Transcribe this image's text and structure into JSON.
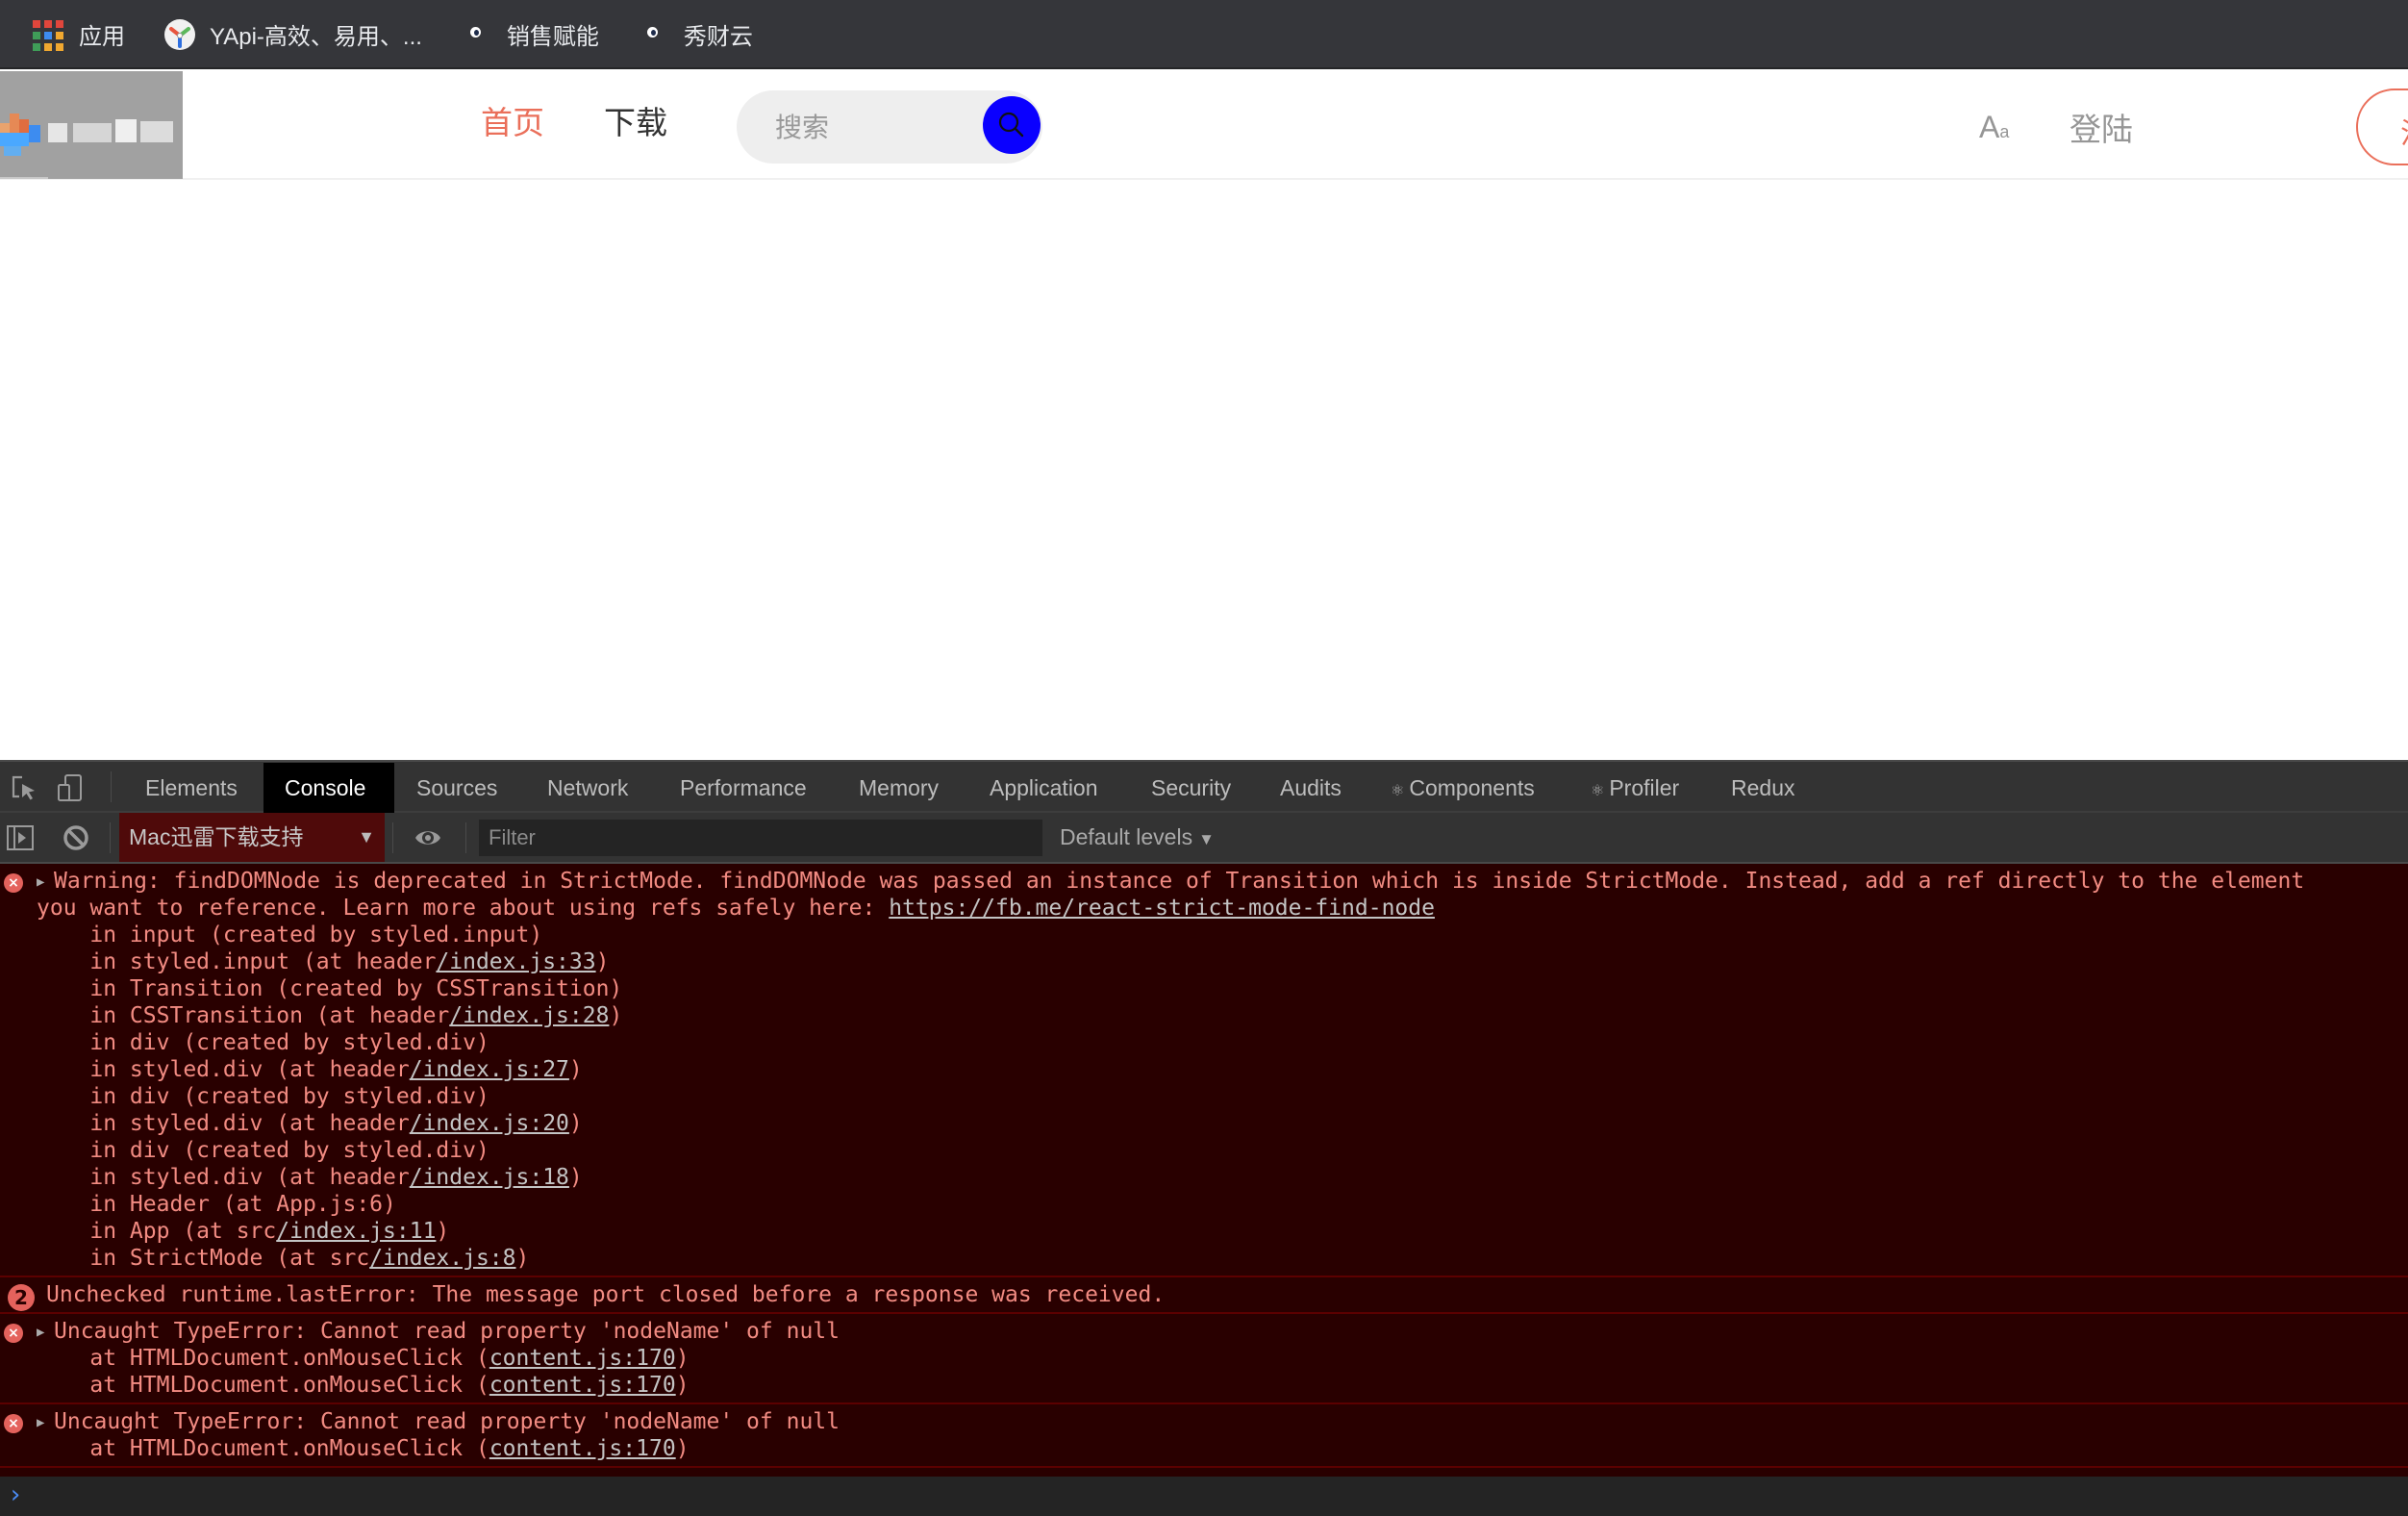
{
  "bookmarks": [
    {
      "label": "应用",
      "icon": "apps-grid-icon"
    },
    {
      "label": "YApi-高效、易用、...",
      "icon": "yapi-logo-icon"
    },
    {
      "label": "销售赋能",
      "icon": "ghost-favicon-icon"
    },
    {
      "label": "秀财云",
      "icon": "ghost-favicon-icon"
    }
  ],
  "site": {
    "nav": [
      {
        "label": "首页",
        "active": true
      },
      {
        "label": "下载",
        "active": false
      }
    ],
    "search": {
      "placeholder": "搜索"
    },
    "font_toggle": {
      "big": "A",
      "small": "a"
    },
    "login_label": "登陆",
    "register_label": "注册",
    "colors": {
      "accent": "#ea6f5a",
      "search_button": "#0a00ff"
    }
  },
  "devtools": {
    "tabs": [
      {
        "label": "Elements",
        "active": false
      },
      {
        "label": "Console",
        "active": true
      },
      {
        "label": "Sources",
        "active": false
      },
      {
        "label": "Network",
        "active": false
      },
      {
        "label": "Performance",
        "active": false
      },
      {
        "label": "Memory",
        "active": false
      },
      {
        "label": "Application",
        "active": false
      },
      {
        "label": "Security",
        "active": false
      },
      {
        "label": "Audits",
        "active": false
      },
      {
        "label": "Components",
        "active": false,
        "react": true
      },
      {
        "label": "Profiler",
        "active": false,
        "react": true
      },
      {
        "label": "Redux",
        "active": false
      }
    ],
    "toolbar": {
      "context": "Mac迅雷下载支持",
      "filter_placeholder": "Filter",
      "levels": "Default levels"
    },
    "messages": [
      {
        "type": "error",
        "expandable": true,
        "lines": [
          {
            "text": "Warning: findDOMNode is deprecated in StrictMode. findDOMNode was passed an instance of Transition which is inside StrictMode. Instead, add a ref directly to the element"
          },
          {
            "text": "you want to reference. Learn more about using refs safely here: ",
            "link": "https://fb.me/react-strict-mode-find-node",
            "after": ""
          },
          {
            "text": "    in input (created by styled.input)"
          },
          {
            "text": "    in styled.input (at header",
            "link": "/index.js:33",
            "after": ")"
          },
          {
            "text": "    in Transition (created by CSSTransition)"
          },
          {
            "text": "    in CSSTransition (at header",
            "link": "/index.js:28",
            "after": ")"
          },
          {
            "text": "    in div (created by styled.div)"
          },
          {
            "text": "    in styled.div (at header",
            "link": "/index.js:27",
            "after": ")"
          },
          {
            "text": "    in div (created by styled.div)"
          },
          {
            "text": "    in styled.div (at header",
            "link": "/index.js:20",
            "after": ")"
          },
          {
            "text": "    in div (created by styled.div)"
          },
          {
            "text": "    in styled.div (at header",
            "link": "/index.js:18",
            "after": ")"
          },
          {
            "text": "    in Header (at App.js:6)"
          },
          {
            "text": "    in App (at src",
            "link": "/index.js:11",
            "after": ")"
          },
          {
            "text": "    in StrictMode (at src",
            "link": "/index.js:8",
            "after": ")"
          }
        ]
      },
      {
        "type": "error",
        "count": "2",
        "lines": [
          {
            "text": "Unchecked runtime.lastError: The message port closed before a response was received."
          }
        ]
      },
      {
        "type": "error",
        "expandable": true,
        "lines": [
          {
            "text": "Uncaught TypeError: Cannot read property 'nodeName' of null"
          },
          {
            "text": "    at HTMLDocument.onMouseClick (",
            "link": "content.js:170",
            "after": ")"
          },
          {
            "text": "    at HTMLDocument.onMouseClick (",
            "link": "content.js:170",
            "after": ")"
          }
        ]
      },
      {
        "type": "error",
        "expandable": true,
        "lines": [
          {
            "text": "Uncaught TypeError: Cannot read property 'nodeName' of null"
          },
          {
            "text": "    at HTMLDocument.onMouseClick (",
            "link": "content.js:170",
            "after": ")"
          }
        ]
      }
    ]
  }
}
